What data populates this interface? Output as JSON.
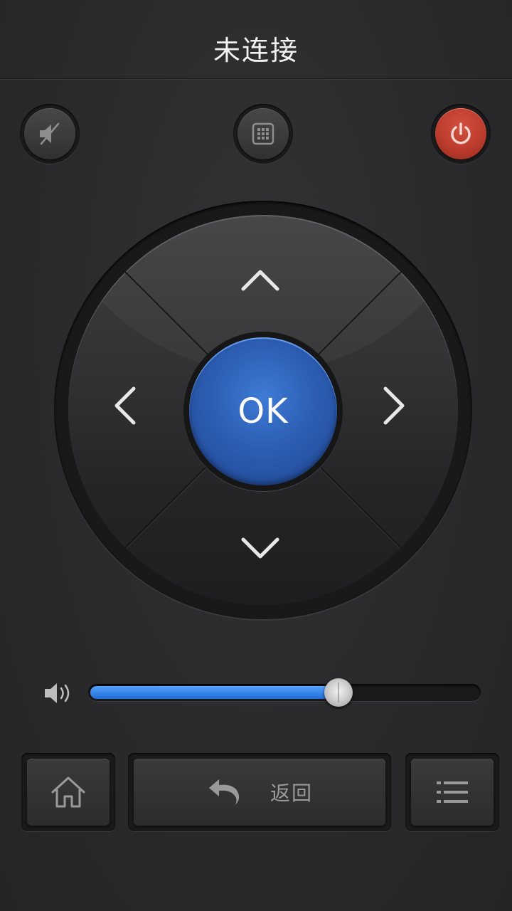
{
  "header": {
    "title": "未连接"
  },
  "top_buttons": {
    "mute": {
      "icon": "mute-speaker-icon"
    },
    "keypad": {
      "icon": "keypad-grid-icon"
    },
    "power": {
      "icon": "power-icon",
      "color": "#c0412f"
    }
  },
  "dpad": {
    "ok_label": "OK",
    "ok_color": "#2d5eb3",
    "arrows": [
      "chevron-up-icon",
      "chevron-down-icon",
      "chevron-left-icon",
      "chevron-right-icon"
    ]
  },
  "volume": {
    "icon": "speaker-volume-icon",
    "level": 0.64,
    "fill_color": "#2f82f0"
  },
  "bottom_bar": {
    "home": {
      "icon": "home-icon"
    },
    "back": {
      "icon": "back-arrow-icon",
      "label": "返回"
    },
    "menu": {
      "icon": "menu-list-icon"
    }
  }
}
